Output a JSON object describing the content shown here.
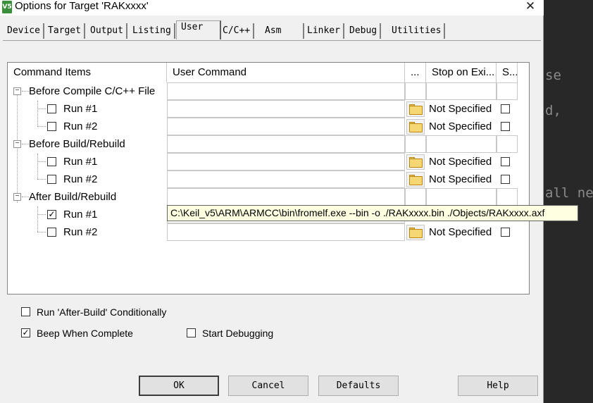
{
  "window": {
    "title": "Options for Target 'RAKxxxx'",
    "icon_text": "V5"
  },
  "tabs": [
    "Device",
    "Target",
    "Output",
    "Listing",
    "User",
    "C/C++",
    "Asm",
    "Linker",
    "Debug",
    "Utilities"
  ],
  "active_tab": "User",
  "grid": {
    "headers": [
      "Command Items",
      "User Command",
      "...",
      "Stop on Exi...",
      "S..."
    ],
    "groups": [
      {
        "label": "Before Compile C/C++ File",
        "rows": [
          {
            "label": "Run #1",
            "checked": false,
            "command": "",
            "stop": "Not Specified",
            "s_checked": false
          },
          {
            "label": "Run #2",
            "checked": false,
            "command": "",
            "stop": "Not Specified",
            "s_checked": false
          }
        ]
      },
      {
        "label": "Before Build/Rebuild",
        "rows": [
          {
            "label": "Run #1",
            "checked": false,
            "command": "",
            "stop": "Not Specified",
            "s_checked": false
          },
          {
            "label": "Run #2",
            "checked": false,
            "command": "",
            "stop": "Not Specified",
            "s_checked": false
          }
        ]
      },
      {
        "label": "After Build/Rebuild",
        "rows": [
          {
            "label": "Run #1",
            "checked": true,
            "command": "",
            "stop": "",
            "s_checked": false
          },
          {
            "label": "Run #2",
            "checked": false,
            "command": "",
            "stop": "Not Specified",
            "s_checked": false
          }
        ]
      }
    ],
    "tooltip": "C:\\Keil_v5\\ARM\\ARMCC\\bin\\fromelf.exe --bin -o ./RAKxxxx.bin ./Objects/RAKxxxx.axf"
  },
  "options": {
    "run_after_build_conditionally": {
      "label": "Run 'After-Build' Conditionally",
      "checked": false
    },
    "beep_when_complete": {
      "label": "Beep When Complete",
      "checked": true
    },
    "start_debugging": {
      "label": "Start Debugging",
      "checked": false
    }
  },
  "buttons": {
    "ok": "OK",
    "cancel": "Cancel",
    "defaults": "Defaults",
    "help": "Help"
  },
  "background_editor": [
    "se",
    "d,",
    "all ne"
  ]
}
